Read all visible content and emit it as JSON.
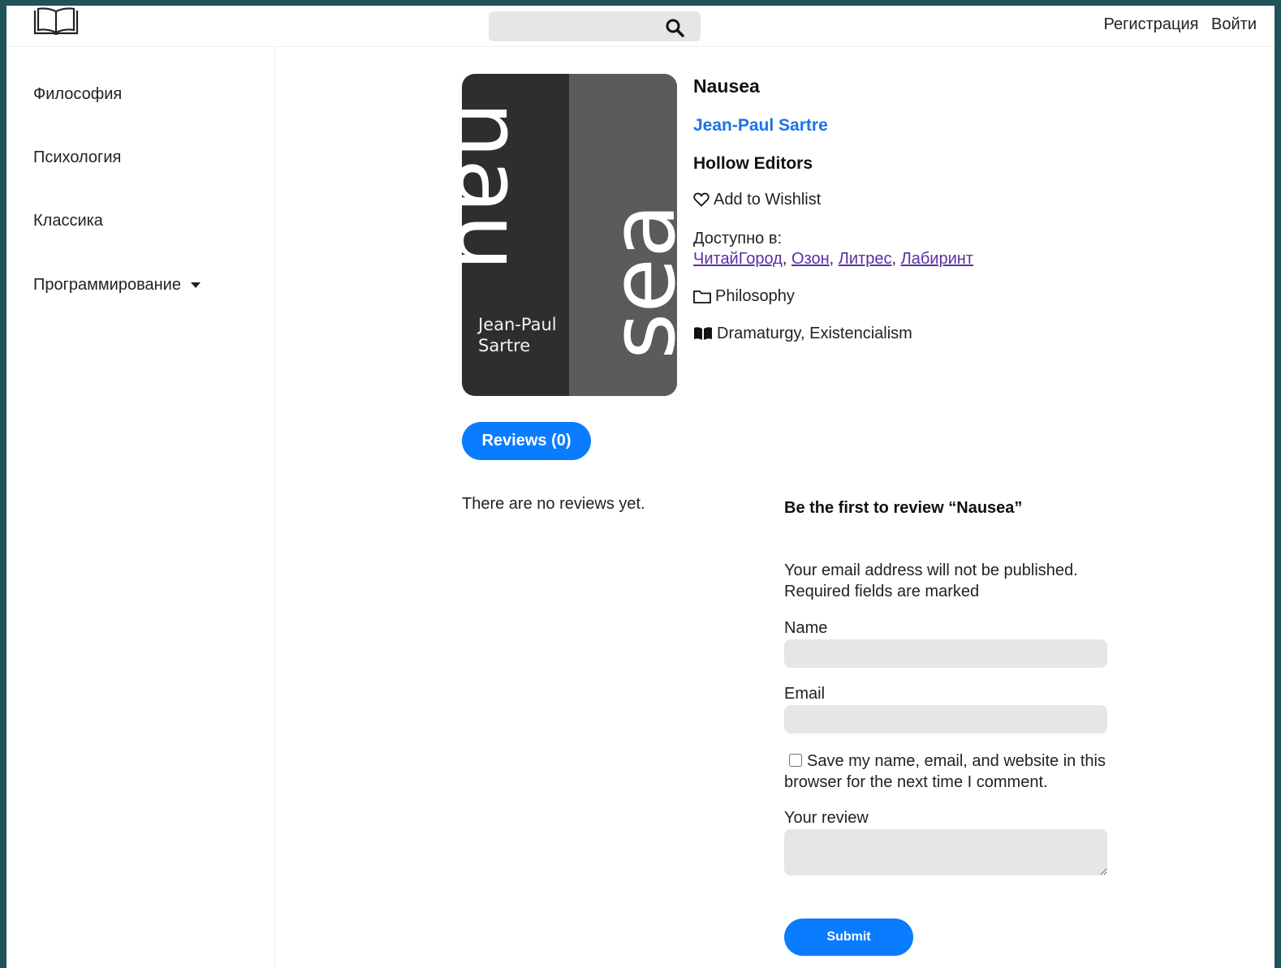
{
  "header": {
    "search": {
      "placeholder": ""
    },
    "auth": {
      "register": "Регистрация",
      "login": "Войти"
    }
  },
  "sidebar": {
    "items": [
      {
        "label": "Философия"
      },
      {
        "label": "Психология"
      },
      {
        "label": "Классика"
      },
      {
        "label": "Программирование",
        "has_dropdown": true
      }
    ]
  },
  "cover": {
    "top_text": "nau",
    "side_text": "sea",
    "author_line1": "Jean-Paul",
    "author_line2": "Sartre",
    "colors": {
      "left": "#2e2e2e",
      "right": "#5b5b5b"
    }
  },
  "book": {
    "title": "Nausea",
    "author": "Jean-Paul Sartre",
    "publisher": "Hollow Editors",
    "wishlist": "Add to Wishlist",
    "available_label": "Доступно в:",
    "stores": [
      "ЧитайГород",
      "Озон",
      "Литрес",
      "Лабиринт"
    ],
    "store_separator": ", ",
    "category": "Philosophy",
    "genres": "Dramaturgy, Existencialism"
  },
  "reviews": {
    "tab_label": "Reviews (0)",
    "empty_text": "There are no reviews yet.",
    "form": {
      "title": "Be the first to review “Nausea”",
      "note_line1": "Your email address will not be published.",
      "note_line2": "Required fields are marked",
      "name_label": "Name",
      "email_label": "Email",
      "save_label": "Save my name, email, and website in this browser for the next time I comment.",
      "review_label": "Your review",
      "submit_label": "Submit"
    }
  },
  "colors": {
    "accent": "#0a7cff",
    "author_link": "#1a73e8",
    "store_link": "#5a2ea6",
    "input_bg": "#e6e6e6",
    "frame_bg": "#1f5459"
  },
  "icons": [
    "open-book-icon",
    "search-icon",
    "heart-icon",
    "folder-icon",
    "book-icon",
    "chevron-down-icon"
  ]
}
